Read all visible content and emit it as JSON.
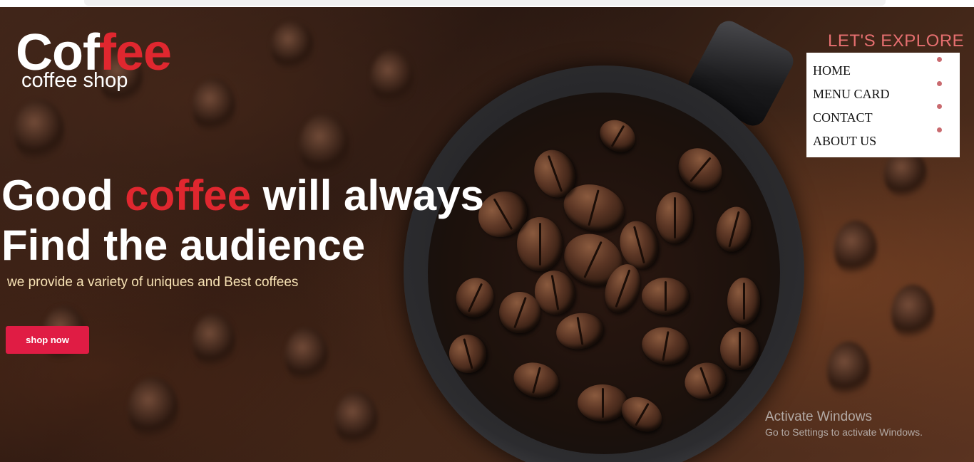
{
  "logo": {
    "main_prefix": "Cof",
    "main_accent": "fee",
    "subtitle": "coffee shop"
  },
  "nav": {
    "heading": "LET'S EXPLORE",
    "items": [
      {
        "label": "HOME"
      },
      {
        "label": "MENU CARD"
      },
      {
        "label": "CONTACT"
      },
      {
        "label": "ABOUT US"
      }
    ]
  },
  "hero": {
    "line1_prefix": "Good ",
    "line1_accent": "coffee",
    "line1_suffix": " will always",
    "line2": "Find the audience",
    "subtitle": "we provide a variety of uniques and Best coffees",
    "cta_label": "shop now"
  },
  "watermark": {
    "title": "Activate Windows",
    "subtitle": "Go to Settings to activate Windows."
  },
  "colors": {
    "accent": "#e0272f",
    "button": "#e01c44",
    "explore": "#e66f70",
    "subtitle": "#f8e3b5"
  }
}
